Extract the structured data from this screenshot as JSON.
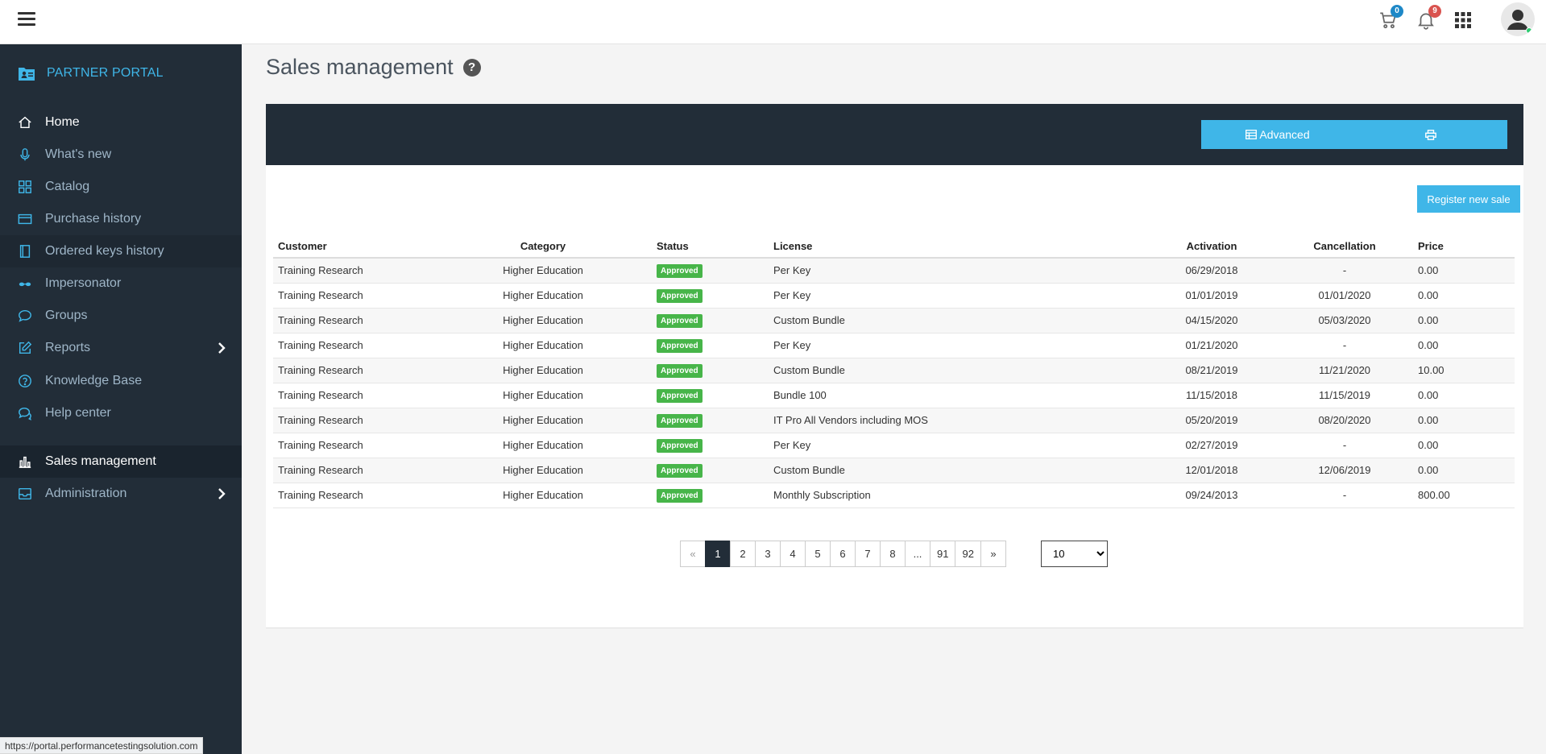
{
  "topbar": {
    "cart_count": "0",
    "notification_count": "9"
  },
  "status_url": "https://portal.performancetestingsolution.com",
  "sidebar": {
    "brand": "PARTNER PORTAL",
    "items": [
      {
        "label": "Home",
        "icon": "home-icon"
      },
      {
        "label": "What's new",
        "icon": "microphone-icon"
      },
      {
        "label": "Catalog",
        "icon": "grid-icon"
      },
      {
        "label": "Purchase history",
        "icon": "credit-card-icon"
      },
      {
        "label": "Ordered keys history",
        "icon": "book-icon"
      },
      {
        "label": "Impersonator",
        "icon": "glasses-icon"
      },
      {
        "label": "Groups",
        "icon": "chat-bubble-icon"
      },
      {
        "label": "Reports",
        "icon": "edit-icon"
      },
      {
        "label": "Knowledge Base",
        "icon": "question-circle-icon"
      },
      {
        "label": "Help center",
        "icon": "comments-icon"
      },
      {
        "label": "Sales management",
        "icon": "bar-chart-icon"
      },
      {
        "label": "Administration",
        "icon": "inbox-icon"
      }
    ]
  },
  "page": {
    "title": "Sales management"
  },
  "toolbar": {
    "advanced_label": "Advanced",
    "register_label": "Register new sale"
  },
  "table": {
    "headers": {
      "customer": "Customer",
      "category": "Category",
      "status": "Status",
      "license": "License",
      "activation": "Activation",
      "cancellation": "Cancellation",
      "price": "Price"
    },
    "rows": [
      {
        "customer": "Training Research",
        "category": "Higher Education",
        "status": "Approved",
        "license": "Per Key",
        "activation": "06/29/2018",
        "cancellation": "-",
        "price": "0.00"
      },
      {
        "customer": "Training Research",
        "category": "Higher Education",
        "status": "Approved",
        "license": "Per Key",
        "activation": "01/01/2019",
        "cancellation": "01/01/2020",
        "price": "0.00"
      },
      {
        "customer": "Training Research",
        "category": "Higher Education",
        "status": "Approved",
        "license": "Custom Bundle",
        "activation": "04/15/2020",
        "cancellation": "05/03/2020",
        "price": "0.00"
      },
      {
        "customer": "Training Research",
        "category": "Higher Education",
        "status": "Approved",
        "license": "Per Key",
        "activation": "01/21/2020",
        "cancellation": "-",
        "price": "0.00"
      },
      {
        "customer": "Training Research",
        "category": "Higher Education",
        "status": "Approved",
        "license": "Custom Bundle",
        "activation": "08/21/2019",
        "cancellation": "11/21/2020",
        "price": "10.00"
      },
      {
        "customer": "Training Research",
        "category": "Higher Education",
        "status": "Approved",
        "license": "Bundle 100",
        "activation": "11/15/2018",
        "cancellation": "11/15/2019",
        "price": "0.00"
      },
      {
        "customer": "Training Research",
        "category": "Higher Education",
        "status": "Approved",
        "license": "IT Pro All Vendors including MOS",
        "activation": "05/20/2019",
        "cancellation": "08/20/2020",
        "price": "0.00"
      },
      {
        "customer": "Training Research",
        "category": "Higher Education",
        "status": "Approved",
        "license": "Per Key",
        "activation": "02/27/2019",
        "cancellation": "-",
        "price": "0.00"
      },
      {
        "customer": "Training Research",
        "category": "Higher Education",
        "status": "Approved",
        "license": "Custom Bundle",
        "activation": "12/01/2018",
        "cancellation": "12/06/2019",
        "price": "0.00"
      },
      {
        "customer": "Training Research",
        "category": "Higher Education",
        "status": "Approved",
        "license": "Monthly Subscription",
        "activation": "09/24/2013",
        "cancellation": "-",
        "price": "800.00"
      }
    ]
  },
  "pagination": {
    "prev": "«",
    "next": "»",
    "pages": [
      "1",
      "2",
      "3",
      "4",
      "5",
      "6",
      "7",
      "8",
      "...",
      "91",
      "92"
    ],
    "current": "1",
    "per_page": "10",
    "per_page_options": [
      "10"
    ]
  },
  "colors": {
    "sidebar_bg": "#222d38",
    "accent": "#3fb6e8",
    "approved": "#47b549"
  }
}
